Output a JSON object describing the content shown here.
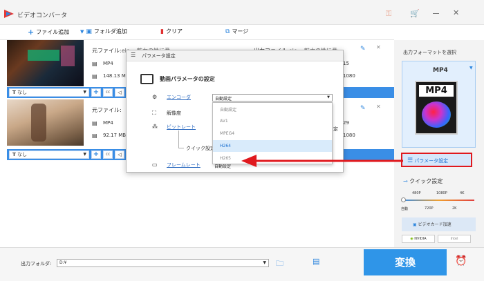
{
  "app": {
    "title": "ビデオコンバータ"
  },
  "toolbar": {
    "add_file": "ファイル追加",
    "add_folder": "フォルダ追加",
    "clear": "クリア",
    "merge": "マージ"
  },
  "files": [
    {
      "source_label": "元ファイル:",
      "source_name": "ele... 魅力の性に番",
      "format": "MP4",
      "size": "148.13 MB",
      "output_label": "出力ファイル:",
      "output_name": "ele... 魅力の性に番",
      "duration": "15",
      "resolution": "1080",
      "subtitle": "なし"
    },
    {
      "source_label": "元ファイル:",
      "source_name": "",
      "format": "MP4",
      "size": "92.17 MB",
      "output_label": "",
      "output_name": "",
      "duration": "29",
      "resolution": "1080",
      "subtitle": "なし"
    }
  ],
  "dialog": {
    "title": "パラメータ設定",
    "section": "動画パラメータの設定",
    "encoder_label": "エンコーダ",
    "resolution_label": "解像度",
    "bitrate_label": "ビットレート",
    "quick_label": "クイック設定",
    "framerate_label": "フレームレート",
    "encoder_value": "自動設定",
    "framerate_value": "自動設定",
    "bitrate_tail": "定",
    "options": [
      "自動設定",
      "AV1",
      "MPEG4",
      "H264",
      "H265"
    ],
    "selected_option": "H264"
  },
  "right_panel": {
    "output_format_label": "出力フォーマットを選択",
    "format": "MP4",
    "param_button": "パラメータ設定",
    "quick_label": "クイック設定",
    "scale_top": [
      "480P",
      "1080P",
      "4K"
    ],
    "scale_bottom": [
      "自動",
      "720P",
      "2K"
    ],
    "gpu_label": "ビデオカード加速",
    "nvidia": "NVIDIA",
    "intel": "Intel"
  },
  "bottom": {
    "folder_label": "出力フォルダ:",
    "folder_value": "D:¥",
    "convert": "変換"
  },
  "colors": {
    "accent": "#3a8ee6",
    "convert": "#2f95e8",
    "arrow": "#e0191e"
  }
}
